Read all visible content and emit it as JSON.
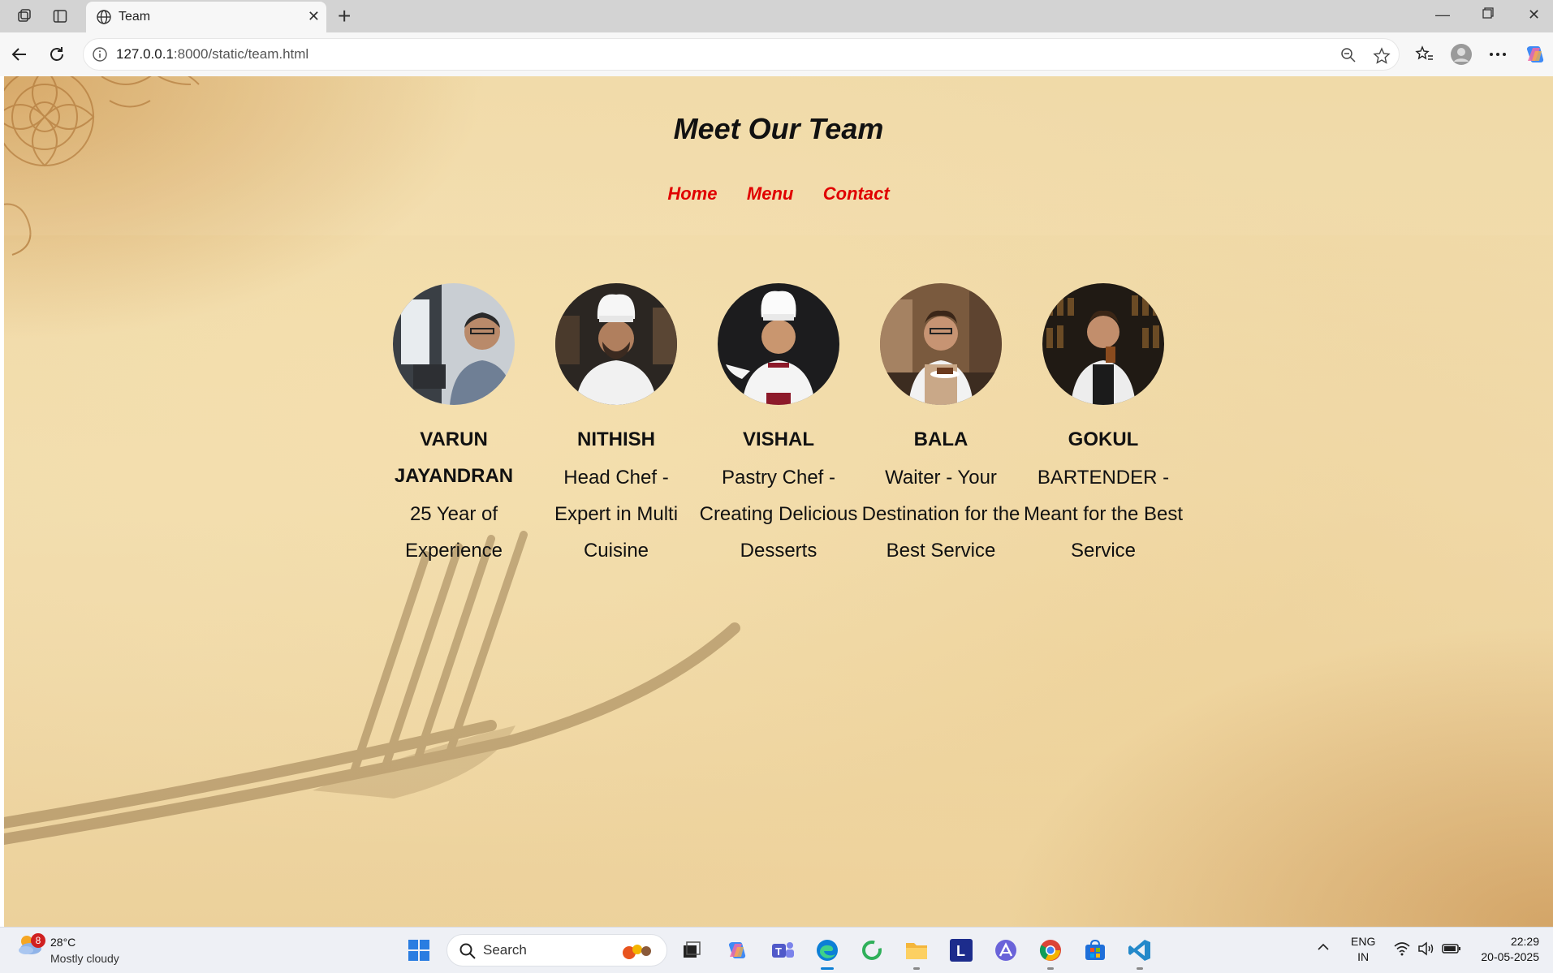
{
  "browser": {
    "tab_title": "Team",
    "url_host": "127.0.0.1",
    "url_path": ":8000/static/team.html"
  },
  "page": {
    "title": "Meet Our Team",
    "nav": [
      {
        "label": "Home"
      },
      {
        "label": "Menu"
      },
      {
        "label": "Contact"
      }
    ],
    "team": [
      {
        "name": "VARUN JAYANDRAN",
        "role": "25 Year of Experience"
      },
      {
        "name": "NITHISH",
        "role": "Head Chef - Expert in Multi Cuisine"
      },
      {
        "name": "VISHAL",
        "role": "Pastry Chef - Creating Delicious Desserts"
      },
      {
        "name": "BALA",
        "role": "Waiter - Your Destination for the Best Service"
      },
      {
        "name": "GOKUL",
        "role": "BARTENDER - Meant for the Best Service"
      }
    ]
  },
  "taskbar": {
    "weather_badge": "8",
    "temperature": "28°C",
    "weather": "Mostly cloudy",
    "search_placeholder": "Search",
    "lang_top": "ENG",
    "lang_bottom": "IN",
    "time": "22:29",
    "date": "20-05-2025"
  },
  "colors": {
    "nav_link": "#e00000",
    "tab_active": "#f7f7f7",
    "chrome_bg": "#d3d3d3"
  }
}
